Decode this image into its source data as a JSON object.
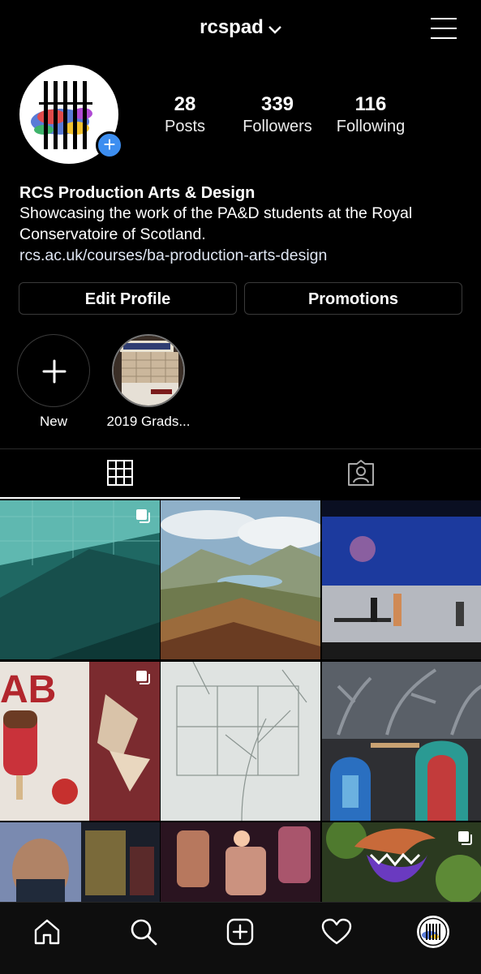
{
  "header": {
    "username": "rcspad"
  },
  "profile": {
    "stats": [
      {
        "value": "28",
        "label": "Posts"
      },
      {
        "value": "339",
        "label": "Followers"
      },
      {
        "value": "116",
        "label": "Following"
      }
    ],
    "display_name": "RCS Production Arts & Design",
    "bio": "Showcasing the work of the PA&D students at the Royal Conservatoire of Scotland.",
    "link": "rcs.ac.uk/courses/ba-production-arts-design"
  },
  "actions": {
    "edit_label": "Edit Profile",
    "promotions_label": "Promotions"
  },
  "highlights": [
    {
      "label": "New",
      "icon": "plus-icon"
    },
    {
      "label": "2019 Grads...",
      "icon": "highlight-cover"
    }
  ],
  "tabs": [
    {
      "icon": "grid-icon",
      "active": true
    },
    {
      "icon": "tagged-icon",
      "active": false
    }
  ],
  "posts": [
    {
      "multi": true
    },
    {
      "multi": false
    },
    {
      "multi": false
    },
    {
      "multi": true
    },
    {
      "multi": false
    },
    {
      "multi": false
    },
    {
      "multi": false
    },
    {
      "multi": false
    },
    {
      "multi": true
    }
  ],
  "bottom_nav": [
    "home-icon",
    "search-icon",
    "new-post-icon",
    "activity-heart-icon",
    "profile-avatar-icon"
  ],
  "colors": {
    "background": "#000000",
    "accent": "#3d8ef0",
    "text": "#ffffff"
  }
}
